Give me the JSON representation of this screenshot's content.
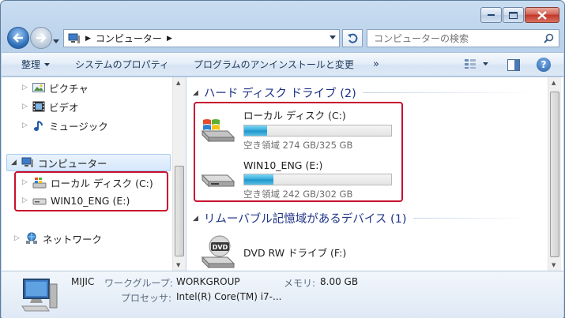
{
  "window": {
    "address": {
      "segments": [
        "コンピューター"
      ],
      "root_icon": "computer-icon"
    },
    "search": {
      "placeholder": "コンピューターの検索"
    }
  },
  "command_bar": {
    "organize": "整理",
    "system_properties": "システムのプロパティ",
    "uninstall": "プログラムのアンインストールと変更",
    "more": "»"
  },
  "nav": {
    "items": [
      {
        "label": "ピクチャ",
        "icon": "pictures-icon"
      },
      {
        "label": "ビデオ",
        "icon": "videos-icon"
      },
      {
        "label": "ミュージック",
        "icon": "music-icon"
      },
      {
        "label": "コンピューター",
        "icon": "computer-icon"
      },
      {
        "label": "ローカル ディスク (C:)",
        "icon": "windows-drive-icon"
      },
      {
        "label": "WIN10_ENG (E:)",
        "icon": "drive-icon"
      },
      {
        "label": "ネットワーク",
        "icon": "network-icon"
      }
    ]
  },
  "content": {
    "groups": [
      {
        "title": "ハード ディスク ドライブ (2)"
      },
      {
        "title": "リムーバブル記憶域があるデバイス (1)"
      }
    ],
    "drives": [
      {
        "name": "ローカル ディスク (C:)",
        "free_text": "空き領域 274 GB/325 GB",
        "used_fraction": 0.157,
        "icon": "windows-drive-icon"
      },
      {
        "name": "WIN10_ENG (E:)",
        "free_text": "空き領域 242 GB/302 GB",
        "used_fraction": 0.199,
        "icon": "drive-icon"
      }
    ],
    "removable": [
      {
        "name": "DVD RW ドライブ (F:)",
        "icon": "dvd-drive-icon",
        "badge": "DVD"
      }
    ]
  },
  "details": {
    "name": "MIJIC",
    "workgroup_label": "ワークグループ:",
    "workgroup_value": "WORKGROUP",
    "memory_label": "メモリ:",
    "memory_value": "8.00 GB",
    "processor_label": "プロセッサ:",
    "processor_value": "Intel(R) Core(TM) i7-..."
  },
  "colors": {
    "highlight_box": "#c8102e",
    "group_header": "#1e3287",
    "bar_fill": "#2fa9d9"
  }
}
